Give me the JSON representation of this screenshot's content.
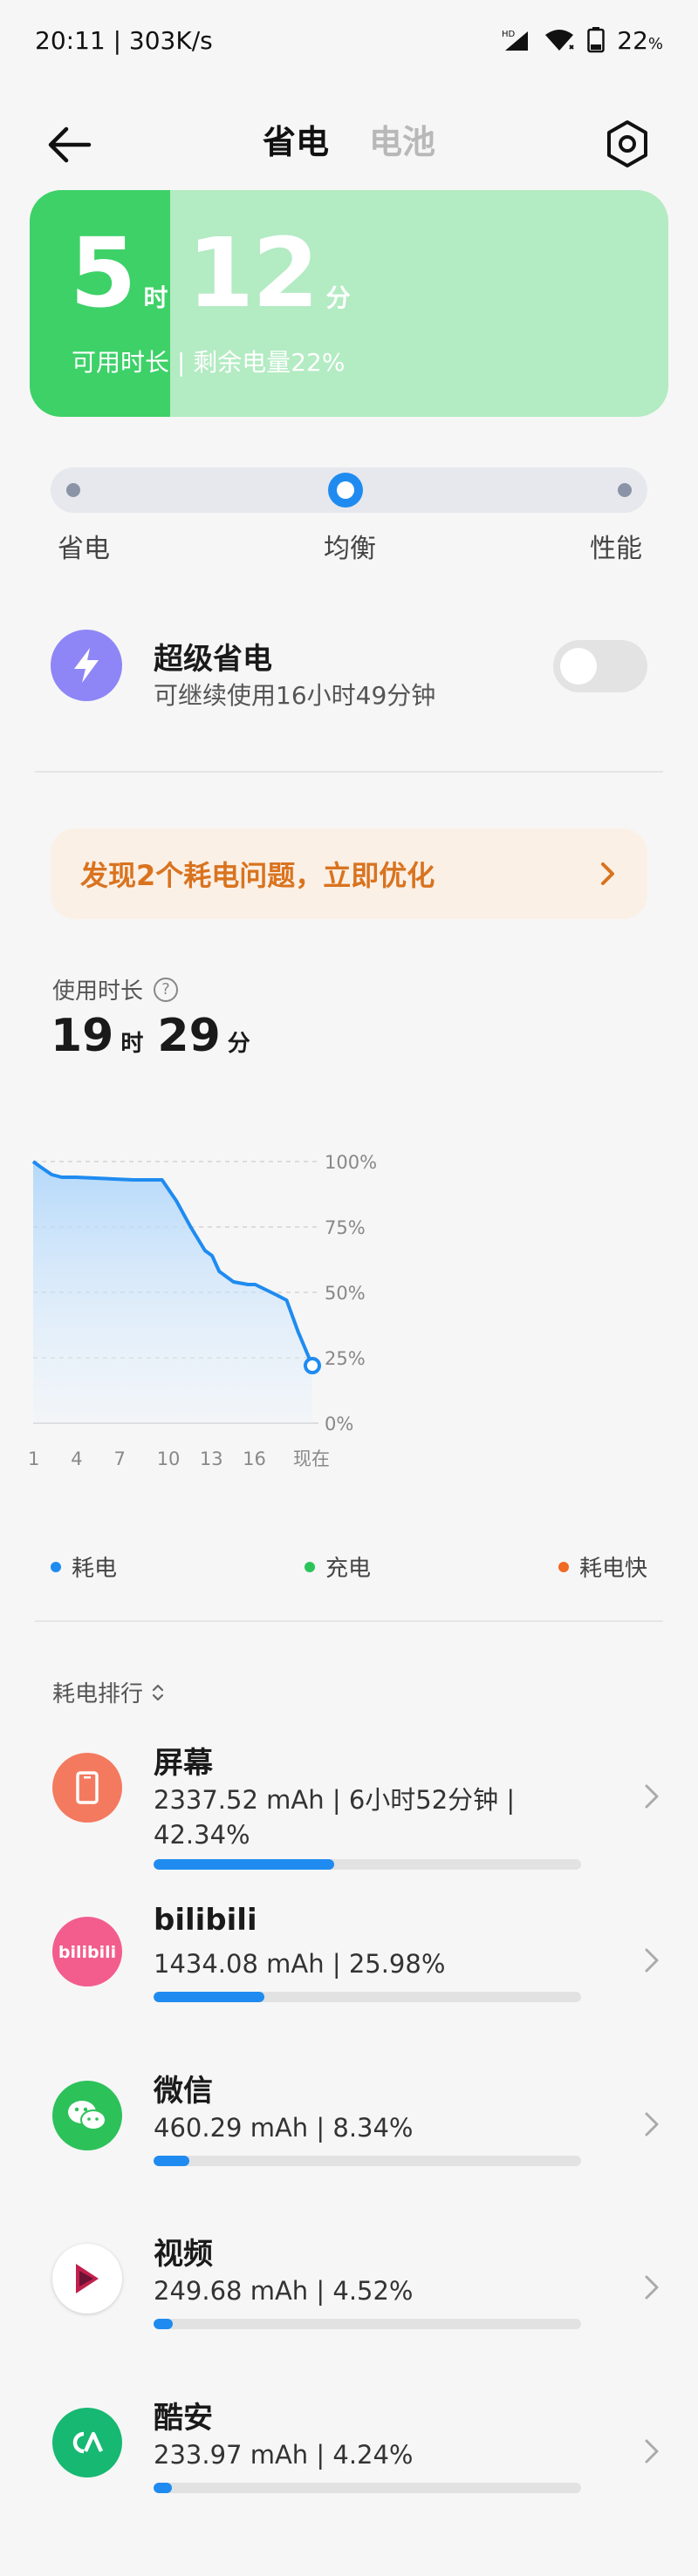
{
  "status_bar": {
    "time_speed": "20:11 | 303K/s",
    "battery": "22",
    "battery_unit": "%",
    "hd": "HD"
  },
  "nav": {
    "tab_save": "省电",
    "tab_battery": "电池"
  },
  "battery_card": {
    "hours": "5",
    "hours_unit": "时",
    "minutes": "12",
    "minutes_unit": "分",
    "subtitle": "可用时长 | 剩余电量22%",
    "level_percent": 22,
    "color_fill": "#3dd168",
    "color_bg": "#b3ebc2"
  },
  "modes": {
    "save": "省电",
    "balanced": "均衡",
    "performance": "性能",
    "selected": "均衡"
  },
  "super_save": {
    "title": "超级省电",
    "subtitle": "可继续使用16小时49分钟",
    "enabled": false
  },
  "issue_banner": {
    "text": "发现2个耗电问题，立即优化",
    "color": "#d9731f"
  },
  "usage": {
    "label": "使用时长",
    "hours": "19",
    "hours_unit": "时",
    "minutes": "29",
    "minutes_unit": "分"
  },
  "chart_data": {
    "type": "area",
    "x_tick_labels": [
      "1",
      "4",
      "7",
      "10",
      "13",
      "16",
      "现在"
    ],
    "y_tick_labels": [
      "100%",
      "75%",
      "50%",
      "25%",
      "0%"
    ],
    "ylim": [
      0,
      100
    ],
    "xlim": [
      1,
      20.5
    ],
    "grid": true,
    "series": [
      {
        "x": [
          1,
          1.5,
          2.3,
          3,
          4,
          6,
          8,
          10,
          11,
          12,
          13,
          13.5,
          14,
          15,
          16,
          16.5,
          18,
          18.7,
          19.5,
          20.5
        ],
        "values": [
          100,
          98,
          95,
          94,
          94,
          93.5,
          93,
          93,
          85,
          75,
          66,
          64,
          58,
          54,
          53,
          53,
          49,
          47,
          35,
          22
        ],
        "color": "#1f8bf0"
      }
    ]
  },
  "legend": [
    {
      "label": "耗电",
      "color": "#1f8bf0"
    },
    {
      "label": "充电",
      "color": "#2cc45a"
    },
    {
      "label": "耗电快",
      "color": "#f06a23"
    }
  ],
  "ranking": {
    "label": "耗电排行",
    "apps": [
      {
        "name": "屏幕",
        "stat": "2337.52 mAh | 6小时52分钟 | 42.34%",
        "percent": 42.34,
        "icon": "screen-icon",
        "icon_color": "#f37a5f"
      },
      {
        "name": "bilibili",
        "stat": "1434.08 mAh | 25.98%",
        "percent": 25.98,
        "icon": "bilibili-icon",
        "icon_color": "#f25d8e"
      },
      {
        "name": "微信",
        "stat": "460.29 mAh | 8.34%",
        "percent": 8.34,
        "icon": "wechat-icon",
        "icon_color": "#2dc15a"
      },
      {
        "name": "视频",
        "stat": "249.68 mAh | 4.52%",
        "percent": 4.52,
        "icon": "video-icon",
        "icon_color": "#c21f4d"
      },
      {
        "name": "酷安",
        "stat": "233.97 mAh | 4.24%",
        "percent": 4.24,
        "icon": "coolapk-icon",
        "icon_color": "#16b872"
      }
    ]
  }
}
